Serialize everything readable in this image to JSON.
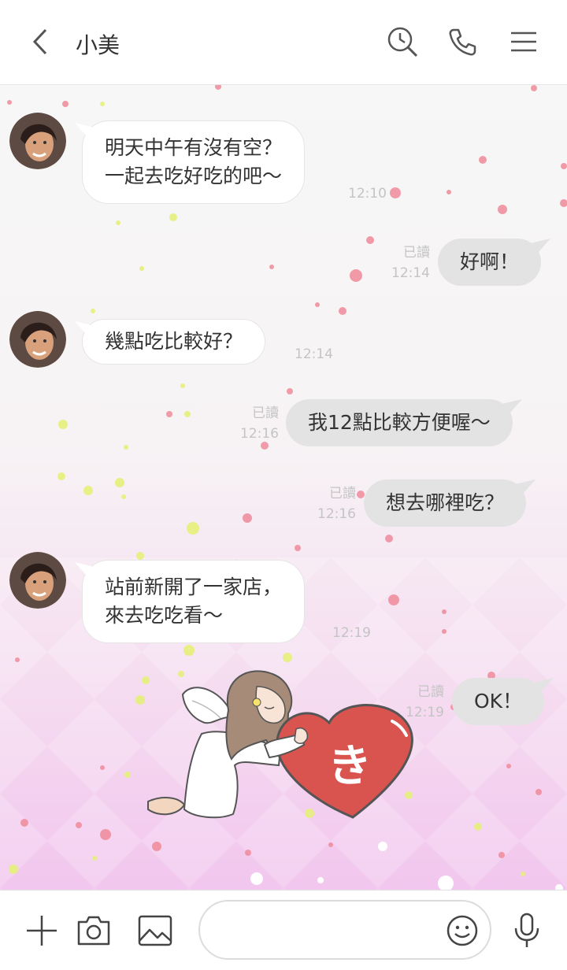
{
  "header": {
    "contact_name": "小美",
    "icons": [
      "back-icon",
      "search-history-icon",
      "phone-icon",
      "menu-icon"
    ]
  },
  "messages": [
    {
      "side": "in",
      "lines": [
        "明天中午有沒有空？",
        "一起去吃好吃的吧～"
      ],
      "time": "12:10"
    },
    {
      "side": "out",
      "text": "好啊！",
      "read": "已讀",
      "time": "12:14"
    },
    {
      "side": "in",
      "lines": [
        "幾點吃比較好？"
      ],
      "time": "12:14"
    },
    {
      "side": "out",
      "text": "我12點比較方便喔～",
      "read": "已讀",
      "time": "12:16"
    },
    {
      "side": "out",
      "text": "想去哪裡吃？",
      "read": "已讀",
      "time": "12:16"
    },
    {
      "side": "in",
      "lines": [
        "站前新開了一家店，",
        "來去吃吃看～"
      ],
      "time": "12:19"
    },
    {
      "side": "out",
      "text": "OK！",
      "read": "已讀",
      "time": "12:19"
    }
  ],
  "sticker": {
    "heart_char": "き",
    "heart_color": "#d9534f"
  },
  "input": {
    "placeholder": "",
    "icons": [
      "plus-icon",
      "camera-icon",
      "image-icon",
      "emoji-icon",
      "microphone-icon"
    ]
  },
  "colors": {
    "incoming_bubble": "#ffffff",
    "outgoing_bubble": "#e3e3e3",
    "timestamp": "#c4c4c4"
  }
}
